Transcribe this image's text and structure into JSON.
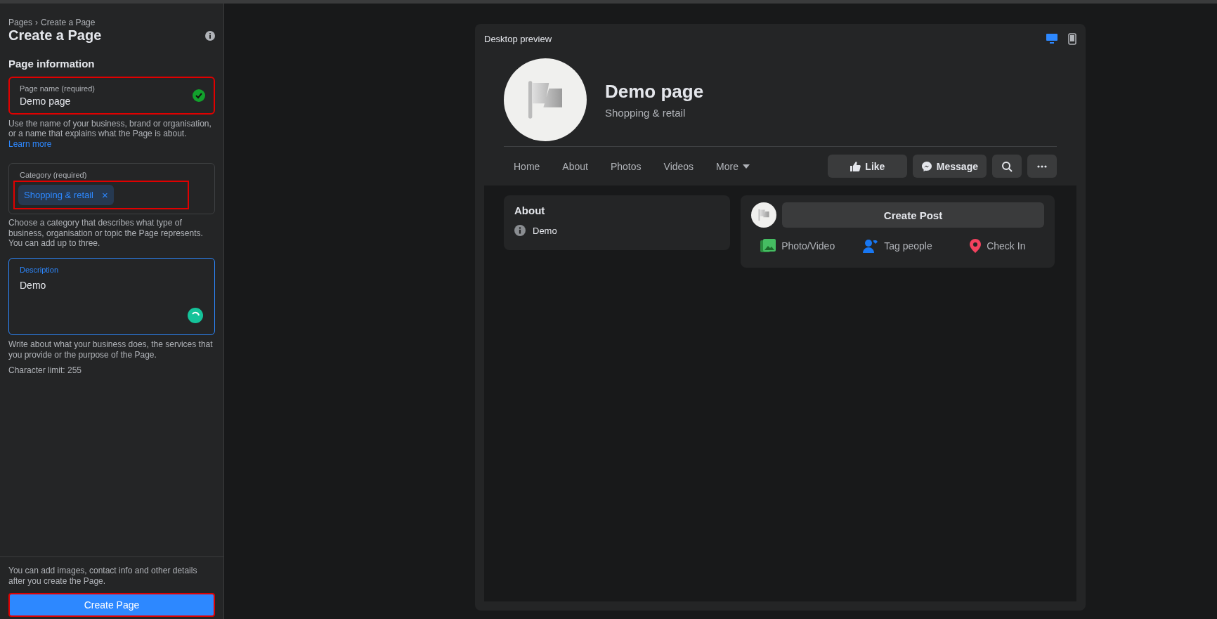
{
  "sidebar": {
    "breadcrumb": [
      {
        "label": "Pages"
      },
      {
        "label": "Create a Page"
      }
    ],
    "breadcrumb_separator": "›",
    "title": "Create a Page",
    "section_title": "Page information",
    "page_name": {
      "label": "Page name (required)",
      "value": "Demo page",
      "valid": true,
      "highlighted": true
    },
    "page_name_help": "Use the name of your business, brand or organisation, or a name that explains what the Page is about.",
    "learn_more": "Learn more",
    "category": {
      "label": "Category (required)",
      "tags": [
        {
          "label": "Shopping & retail",
          "remove": "×"
        }
      ],
      "highlighted": true
    },
    "category_help": "Choose a category that describes what type of business, organisation or topic the Page represents. You can add up to three.",
    "description": {
      "label": "Description",
      "value": "Demo",
      "focused": true
    },
    "description_help": "Write about what your business does, the services that you provide or the purpose of the Page.",
    "character_limit": "Character limit: 255",
    "footer_note": "You can add images, contact info and other details after you create the Page.",
    "create_button": {
      "label": "Create Page",
      "highlighted": true
    }
  },
  "preview": {
    "title": "Desktop preview",
    "devices": [
      {
        "kind": "desktop",
        "selected": true
      },
      {
        "kind": "mobile",
        "selected": false
      }
    ],
    "page_name": "Demo page",
    "category": "Shopping & retail",
    "nav": [
      {
        "label": "Home"
      },
      {
        "label": "About"
      },
      {
        "label": "Photos"
      },
      {
        "label": "Videos"
      },
      {
        "label": "More",
        "dropdown": true
      }
    ],
    "actions": [
      {
        "kind": "like",
        "label": "Like"
      },
      {
        "kind": "message",
        "label": "Message"
      },
      {
        "kind": "search"
      },
      {
        "kind": "more"
      }
    ],
    "about": {
      "title": "About",
      "text": "Demo"
    },
    "composer": {
      "button": "Create Post",
      "options": [
        {
          "kind": "photo",
          "label": "Photo/Video"
        },
        {
          "kind": "tag",
          "label": "Tag people"
        },
        {
          "kind": "checkin",
          "label": "Check In"
        }
      ]
    }
  }
}
